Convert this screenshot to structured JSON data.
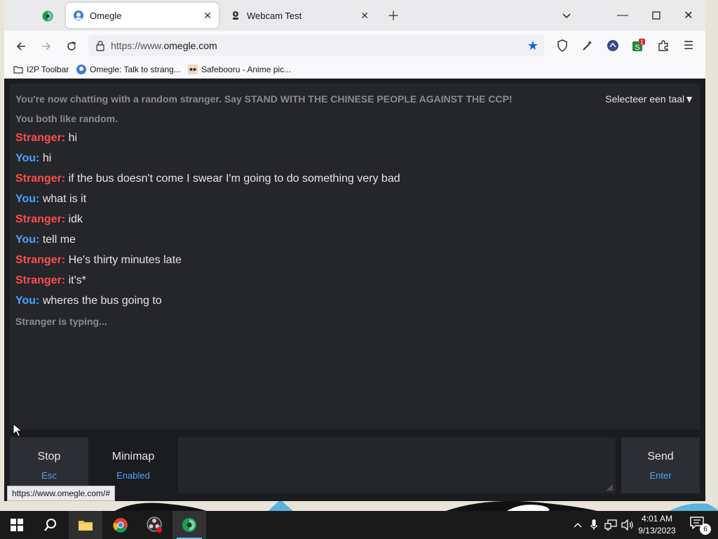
{
  "browser": {
    "tabs": [
      {
        "label": "Omegle",
        "active": true,
        "icon": "omegle-icon"
      },
      {
        "label": "Webcam Test",
        "active": false,
        "icon": "webcam-icon"
      }
    ],
    "url_prefix": "https://www.",
    "url_host": "omegle.com",
    "bookmarks": [
      {
        "label": "I2P Toolbar",
        "icon": "folder-icon"
      },
      {
        "label": "Omegle: Talk to strang...",
        "icon": "omegle-icon"
      },
      {
        "label": "Safebooru - Anime pic...",
        "icon": "safebooru-icon"
      }
    ],
    "extension_badge": "1",
    "status_url": "https://www.omegle.com/#"
  },
  "chat": {
    "system_top": "You're now chatting with a random stranger. Say STAND WITH THE CHINESE PEOPLE AGAINST THE CCP!",
    "common_likes": "You both like random.",
    "language_select": "Selecteer een taal▼",
    "messages": [
      {
        "from": "Stranger:",
        "text": "hi",
        "role": "stranger"
      },
      {
        "from": "You:",
        "text": "hi",
        "role": "you"
      },
      {
        "from": "Stranger:",
        "text": "if the bus doesn't come I swear I'm going to do something very bad",
        "role": "stranger"
      },
      {
        "from": "You:",
        "text": "what is it",
        "role": "you"
      },
      {
        "from": "Stranger:",
        "text": "idk",
        "role": "stranger"
      },
      {
        "from": "You:",
        "text": "tell me",
        "role": "you"
      },
      {
        "from": "Stranger:",
        "text": "He's thirty minutes late",
        "role": "stranger"
      },
      {
        "from": "Stranger:",
        "text": "it's*",
        "role": "stranger"
      },
      {
        "from": "You:",
        "text": "wheres the bus going to",
        "role": "you"
      }
    ],
    "typing": "Stranger is typing..."
  },
  "controls": {
    "stop_label": "Stop",
    "stop_key": "Esc",
    "minimap_label": "Minimap",
    "minimap_state": "Enabled",
    "send_label": "Send",
    "send_key": "Enter",
    "message_value": ""
  },
  "taskbar": {
    "apps": [
      "windows-start-icon",
      "search-icon",
      "file-explorer-icon",
      "chrome-icon",
      "obs-icon",
      "tor-browser-icon"
    ],
    "time": "4:01 AM",
    "date": "9/13/2023",
    "notification_count": "6"
  },
  "colors": {
    "stranger": "#ff4d4d",
    "you": "#4aa3ff",
    "page_bg": "#1b1c1f",
    "chat_bg": "#25262a"
  }
}
